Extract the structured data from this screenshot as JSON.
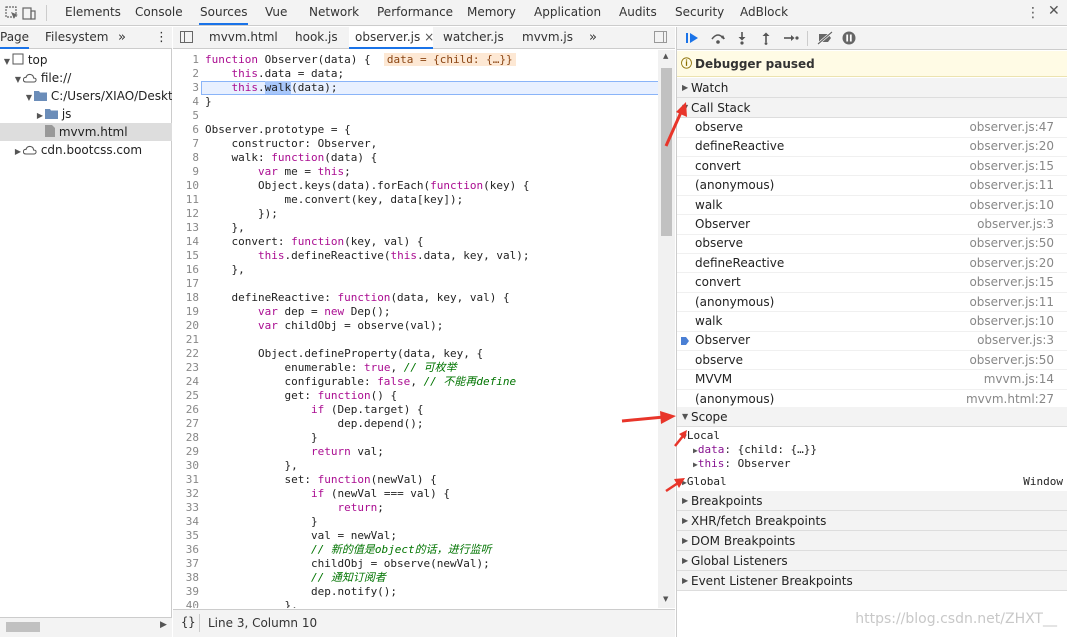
{
  "top_tabs": [
    "Elements",
    "Console",
    "Sources",
    "Vue",
    "Network",
    "Performance",
    "Memory",
    "Application",
    "Audits",
    "Security",
    "AdBlock"
  ],
  "active_top_tab": "Sources",
  "nav": {
    "tabs": [
      "Page",
      "Filesystem"
    ],
    "more_label": "»",
    "menu_label": "⋮",
    "tree": [
      {
        "label": "top",
        "indent": 0,
        "icon": "frame-icon",
        "expanded": true
      },
      {
        "label": "file://",
        "indent": 1,
        "icon": "cloud-icon",
        "expanded": true
      },
      {
        "label": "C:/Users/XIAO/Desktop/",
        "indent": 2,
        "icon": "folder-icon",
        "expanded": true
      },
      {
        "label": "js",
        "indent": 3,
        "icon": "folder-icon",
        "expanded": false
      },
      {
        "label": "mvvm.html",
        "indent": 3,
        "icon": "file-icon",
        "selected": true
      },
      {
        "label": "cdn.bootcss.com",
        "indent": 1,
        "icon": "cloud-icon",
        "expanded": false
      }
    ]
  },
  "editor": {
    "tabs": [
      "mvvm.html",
      "hook.js",
      "observer.js",
      "watcher.js",
      "mvvm.js"
    ],
    "active_tab": "observer.js",
    "close_label": "×",
    "more_label": "»",
    "lines": [
      "function Observer(data) {",
      "    this.data = data;",
      "    this.walk(data);",
      "}",
      "",
      "Observer.prototype = {",
      "    constructor: Observer,",
      "    walk: function(data) {",
      "        var me = this;",
      "        Object.keys(data).forEach(function(key) {",
      "            me.convert(key, data[key]);",
      "        });",
      "    },",
      "    convert: function(key, val) {",
      "        this.defineReactive(this.data, key, val);",
      "    },",
      "",
      "    defineReactive: function(data, key, val) {",
      "        var dep = new Dep();",
      "        var childObj = observe(val);",
      "",
      "        Object.defineProperty(data, key, {",
      "            enumerable: true, // 可枚举",
      "            configurable: false, // 不能再define",
      "            get: function() {",
      "                if (Dep.target) {",
      "                    dep.depend();",
      "                }",
      "                return val;",
      "            },",
      "            set: function(newVal) {",
      "                if (newVal === val) {",
      "                    return;",
      "                }",
      "                val = newVal;",
      "                // 新的值是object的话，进行监听",
      "                childObj = observe(newVal);",
      "                // 通知订阅者",
      "                dep.notify();",
      "            },"
    ],
    "inline_value": "data = {child: {…}}",
    "paused_line": 3,
    "status": "Line 3, Column 10",
    "status_icon": "{}"
  },
  "debugger": {
    "paused_text": "Debugger paused",
    "sections": {
      "watch": "Watch",
      "call_stack": "Call Stack",
      "scope": "Scope",
      "breakpoints": "Breakpoints",
      "xhr": "XHR/fetch Breakpoints",
      "dom": "DOM Breakpoints",
      "global_listeners": "Global Listeners",
      "event_listeners": "Event Listener Breakpoints"
    },
    "call_stack": [
      {
        "fn": "observe",
        "loc": "observer.js:47"
      },
      {
        "fn": "defineReactive",
        "loc": "observer.js:20"
      },
      {
        "fn": "convert",
        "loc": "observer.js:15"
      },
      {
        "fn": "(anonymous)",
        "loc": "observer.js:11"
      },
      {
        "fn": "walk",
        "loc": "observer.js:10"
      },
      {
        "fn": "Observer",
        "loc": "observer.js:3"
      },
      {
        "fn": "observe",
        "loc": "observer.js:50"
      },
      {
        "fn": "defineReactive",
        "loc": "observer.js:20"
      },
      {
        "fn": "convert",
        "loc": "observer.js:15"
      },
      {
        "fn": "(anonymous)",
        "loc": "observer.js:11"
      },
      {
        "fn": "walk",
        "loc": "observer.js:10"
      },
      {
        "fn": "Observer",
        "loc": "observer.js:3",
        "current": true
      },
      {
        "fn": "observe",
        "loc": "observer.js:50"
      },
      {
        "fn": "MVVM",
        "loc": "mvvm.js:14"
      },
      {
        "fn": "(anonymous)",
        "loc": "mvvm.html:27"
      }
    ],
    "scope": {
      "local_label": "Local",
      "local_props": [
        {
          "name": "data",
          "value": "{child: {…}}"
        },
        {
          "name": "this",
          "value": "Observer"
        }
      ],
      "global_label": "Global",
      "global_value": "Window"
    }
  },
  "watermark": "https://blog.csdn.net/ZHXT__",
  "colors": {
    "accent": "#1a73e8",
    "arrow": "#e8352a",
    "paused_bg": "#fffbe5"
  }
}
